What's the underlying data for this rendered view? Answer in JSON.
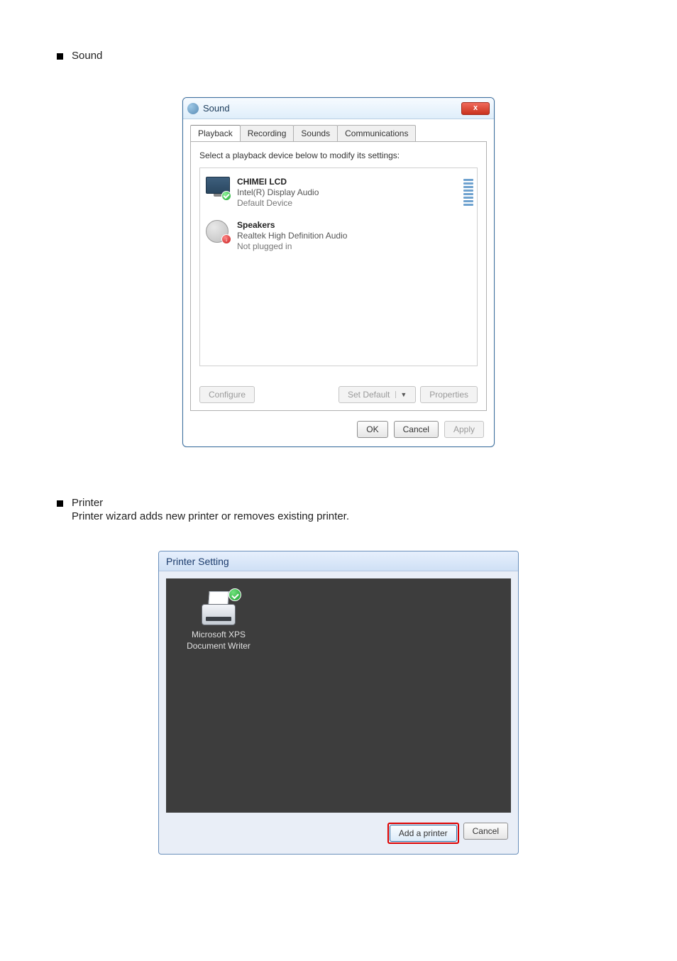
{
  "bullets": {
    "sound": {
      "label": "Sound"
    },
    "printer": {
      "label": "Printer",
      "desc": "Printer wizard adds new printer or removes existing printer."
    }
  },
  "sound_dialog": {
    "title": "Sound",
    "close_label": "x",
    "tabs": {
      "playback": "Playback",
      "recording": "Recording",
      "sounds": "Sounds",
      "communications": "Communications"
    },
    "description": "Select a playback device below to modify its settings:",
    "devices": [
      {
        "name": "CHIMEI LCD",
        "sub": "Intel(R) Display Audio",
        "status": "Default Device"
      },
      {
        "name": "Speakers",
        "sub": "Realtek High Definition Audio",
        "status": "Not plugged in"
      }
    ],
    "buttons": {
      "configure": "Configure",
      "set_default": "Set Default",
      "properties": "Properties",
      "ok": "OK",
      "cancel": "Cancel",
      "apply": "Apply"
    }
  },
  "printer_dialog": {
    "title": "Printer Setting",
    "items": [
      {
        "label_line1": "Microsoft XPS",
        "label_line2": "Document Writer"
      }
    ],
    "buttons": {
      "add": "Add a printer",
      "cancel": "Cancel"
    }
  }
}
